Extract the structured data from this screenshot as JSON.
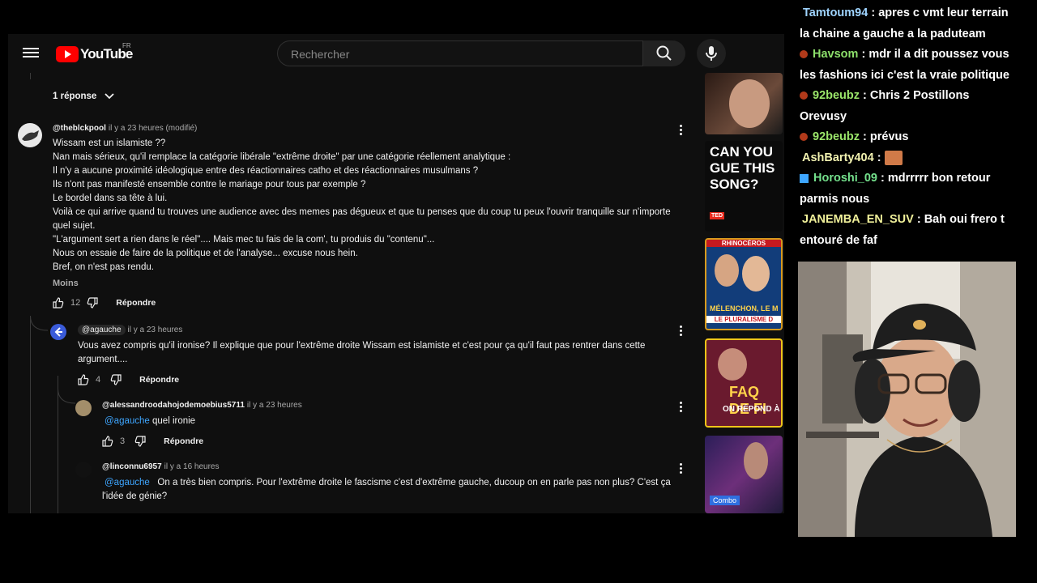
{
  "header": {
    "logo_text": "YouTube",
    "region": "FR",
    "search_placeholder": "Rechercher"
  },
  "replies_toggle": "1 réponse",
  "comment_main": {
    "author": "@theblckpool",
    "time": "il y a 23 heures (modifié)",
    "lines": [
      "Wissam est un islamiste ??",
      "Nan mais sérieux, qu'il remplace la catégorie libérale \"extrême droite\" par une catégorie réellement analytique :",
      "Il n'y a aucune proximité idéologique entre des réactionnaires catho et des réactionnaires musulmans ?",
      "Ils n'ont pas manifesté ensemble contre le mariage pour tous par exemple ?",
      "Le bordel dans sa tête à lui.",
      "Voilà ce qui arrive quand tu trouves une audience avec des memes pas dégueux et que tu penses que du coup tu peux l'ouvrir tranquille sur n'importe",
      "quel sujet.",
      "\"L'argument sert a rien dans le réel\".... Mais mec tu fais de la com', tu produis du \"contenu\"...",
      "Nous on essaie de faire de la politique et de l'analyse... excuse nous hein.",
      "Bref, on n'est pas rendu."
    ],
    "show_less": "Moins",
    "likes": "12",
    "reply_label": "Répondre"
  },
  "reply1": {
    "author": "@agauche",
    "time": "il y a 23 heures",
    "text_line1": "Vous avez compris qu'il ironise? Il explique que pour l'extrême droite Wissam est islamiste et c'est pour ça qu'il faut pas rentrer dans cette",
    "text_line2": "argument....",
    "likes": "4",
    "reply_label": "Répondre"
  },
  "reply2": {
    "author": "@alessandroodahojodemoebius5711",
    "time": "il y a 23 heures",
    "mention": "@agauche",
    "text": "quel ironie",
    "likes": "3",
    "reply_label": "Répondre"
  },
  "reply3": {
    "author": "@linconnu6957",
    "time": "il y a 16 heures",
    "mention": "@agauche",
    "text_line1": "On a très bien compris. Pour l'extrême droite le fascisme c'est d'extrême gauche, ducoup on en parle pas non plus? C'est ça",
    "text_line2": "l'idée de génie?"
  },
  "thumbnails": [
    {
      "text": ""
    },
    {
      "text": "CAN YOU GUE THIS SONG?",
      "badge": "TED"
    },
    {
      "top": "RHINOCÉROS",
      "bottom": "MÉLENCHON, LE M",
      "bottom2": "LE PLURALISME D"
    },
    {
      "text": "FAQ DE FI",
      "sub": "ON RÉPOND À"
    },
    {
      "badge": "Combo"
    }
  ],
  "chat": [
    {
      "user": "Tamtoum94",
      "msg": "apres c vmt leur terrain la chaine a gauche a la paduteam",
      "color": "#9fd4ff",
      "badge": false
    },
    {
      "user": "Havsom",
      "msg": "mdr il a dit poussez vous les fashions ici c'est la vraie politique",
      "color": "#8de06b",
      "badge": true
    },
    {
      "user": "92beubz",
      "msg": "Chris 2 Postillons Orevusy",
      "color": "#9be66a",
      "badge": true
    },
    {
      "user": "92beubz",
      "msg": "prévus",
      "color": "#9be66a",
      "badge": true
    },
    {
      "user": "AshBarty404",
      "msg": "",
      "color": "#f2f2b0",
      "badge": false
    },
    {
      "user": "Horoshi_09",
      "msg": "mdrrrrr bon retour parmis nous",
      "color": "#74e08c",
      "badge": true
    },
    {
      "user": "JANEMBA_EN_SUV",
      "msg": "Bah oui frero t entouré de faf",
      "color": "#f0f09a",
      "badge": false
    }
  ],
  "colors": {
    "accent_link": "#3ea6ff",
    "yt_red": "#ff0000",
    "bg": "#0f0f0f"
  }
}
